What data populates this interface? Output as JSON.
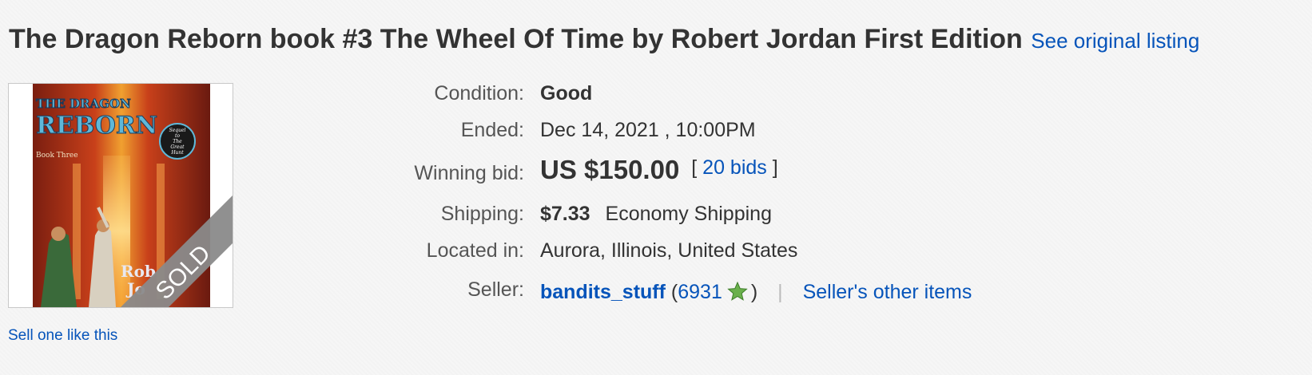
{
  "listing": {
    "title": "The Dragon Reborn book #3 The Wheel Of Time by Robert Jordan First Edition",
    "see_original_label": "See original listing",
    "image": {
      "book_title_line1": "THE DRAGON",
      "book_title_line2": "REBORN",
      "sequel_badge_line1": "Sequel",
      "sequel_badge_line2": "to",
      "sequel_badge_line3": "The",
      "sequel_badge_line4": "Great",
      "sequel_badge_line5": "Hunt",
      "book_subtitle": "Book Three",
      "author_fragment": "Rob",
      "author_fragment2": "Jo",
      "sold_ribbon_text": "SOLD"
    },
    "sell_one_label": "Sell one like this"
  },
  "details": {
    "condition": {
      "label": "Condition:",
      "value": "Good"
    },
    "ended": {
      "label": "Ended:",
      "value": "Dec 14, 2021 , 10:00PM"
    },
    "winning_bid": {
      "label": "Winning bid:",
      "price": "US $150.00",
      "bids_open": "[",
      "bids_label": "20 bids",
      "bids_close": "]"
    },
    "shipping": {
      "label": "Shipping:",
      "cost": "$7.33",
      "method": "Economy Shipping"
    },
    "located": {
      "label": "Located in:",
      "value": "Aurora, Illinois, United States"
    },
    "seller": {
      "label": "Seller:",
      "name": "bandits_stuff",
      "feedback_open": "(",
      "feedback_score": "6931",
      "feedback_close": ")",
      "separator": "|",
      "other_items_label": "Seller's other items"
    }
  },
  "colors": {
    "link": "#0654ba",
    "star": "#6ab04c",
    "sold_ribbon": "#8a8a8a"
  }
}
